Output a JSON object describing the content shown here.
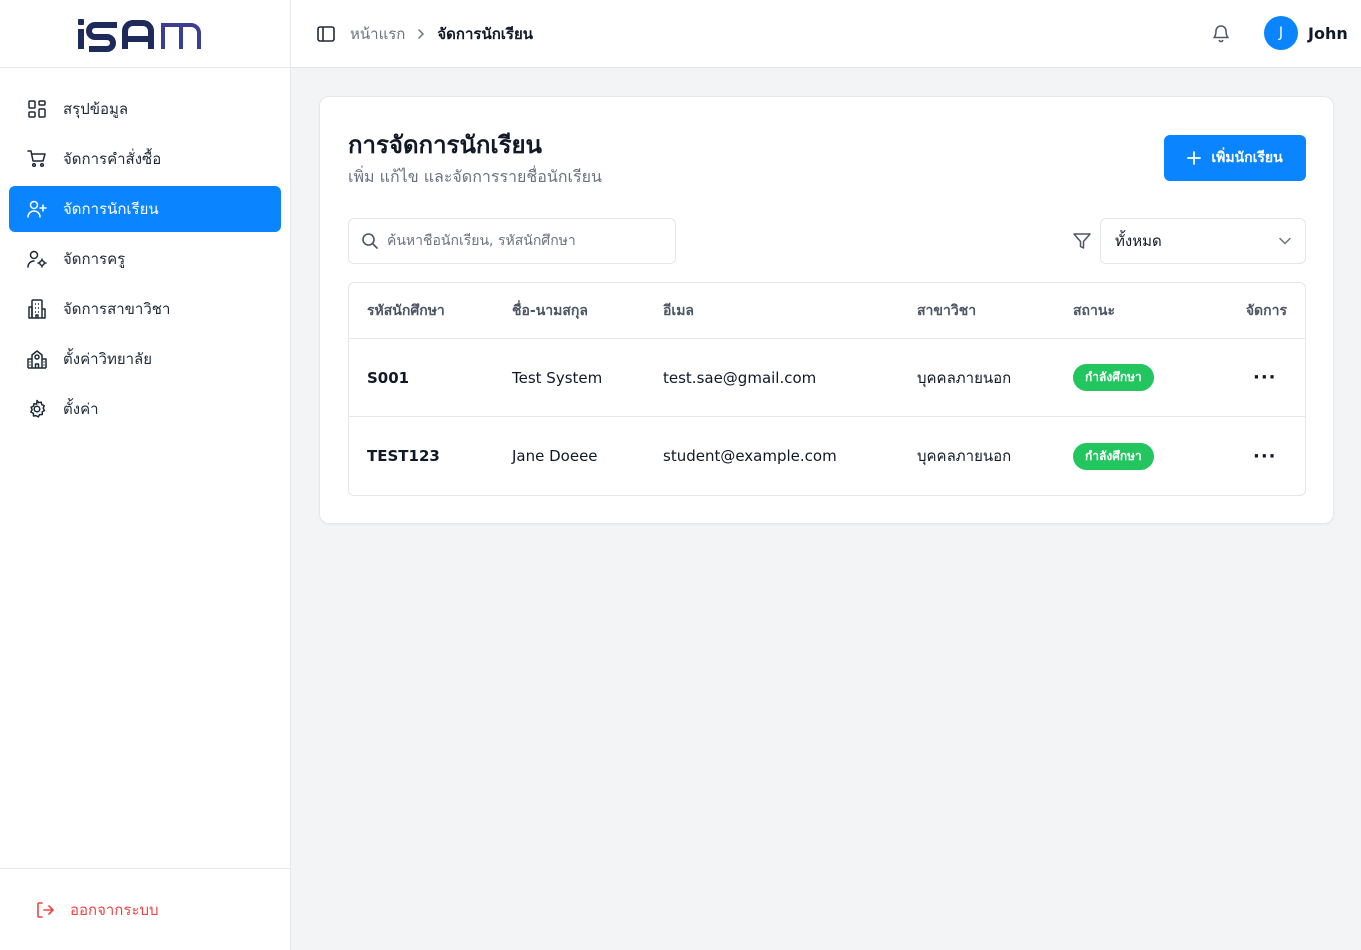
{
  "logo": {
    "text": "iSAM"
  },
  "sidebar": {
    "items": [
      {
        "label": "สรุปข้อมูล",
        "icon": "dashboard-icon",
        "active": false
      },
      {
        "label": "จัดการคำสั่งซื้อ",
        "icon": "cart-icon",
        "active": false
      },
      {
        "label": "จัดการนักเรียน",
        "icon": "user-plus-icon",
        "active": true
      },
      {
        "label": "จัดการครู",
        "icon": "user-cog-icon",
        "active": false
      },
      {
        "label": "จัดการสาขาวิชา",
        "icon": "building-icon",
        "active": false
      },
      {
        "label": "ตั้งค่าวิทยาลัย",
        "icon": "school-icon",
        "active": false
      },
      {
        "label": "ตั้งค่า",
        "icon": "gear-icon",
        "active": false
      }
    ],
    "logout_label": "ออกจากระบบ"
  },
  "header": {
    "breadcrumb": {
      "home": "หน้าแรก",
      "current": "จัดการนักเรียน"
    },
    "user": {
      "initial": "J",
      "name": "John"
    }
  },
  "main": {
    "title": "การจัดการนักเรียน",
    "subtitle": "เพิ่ม แก้ไข และจัดการรายชื่อนักเรียน",
    "add_button_label": "เพิ่มนักเรียน",
    "search_placeholder": "ค้นหาชื่อนักเรียน, รหัสนักศึกษา",
    "filter_value": "ทั้งหมด",
    "table": {
      "columns": [
        "รหัสนักศึกษา",
        "ชื่อ-นามสกุล",
        "อีเมล",
        "สาขาวิชา",
        "สถานะ",
        "จัดการ"
      ],
      "rows": [
        {
          "id": "S001",
          "name": "Test System",
          "email": "test.sae@gmail.com",
          "major": "บุคคลภายนอก",
          "status": "กำลังศึกษา",
          "action": "···"
        },
        {
          "id": "TEST123",
          "name": "Jane Doeee",
          "email": "student@example.com",
          "major": "บุคคลภายนอก",
          "status": "กำลังศึกษา",
          "action": "···"
        }
      ]
    }
  },
  "colors": {
    "accent": "#0a84ff",
    "status_green": "#22c55e",
    "danger": "#ef4444"
  }
}
